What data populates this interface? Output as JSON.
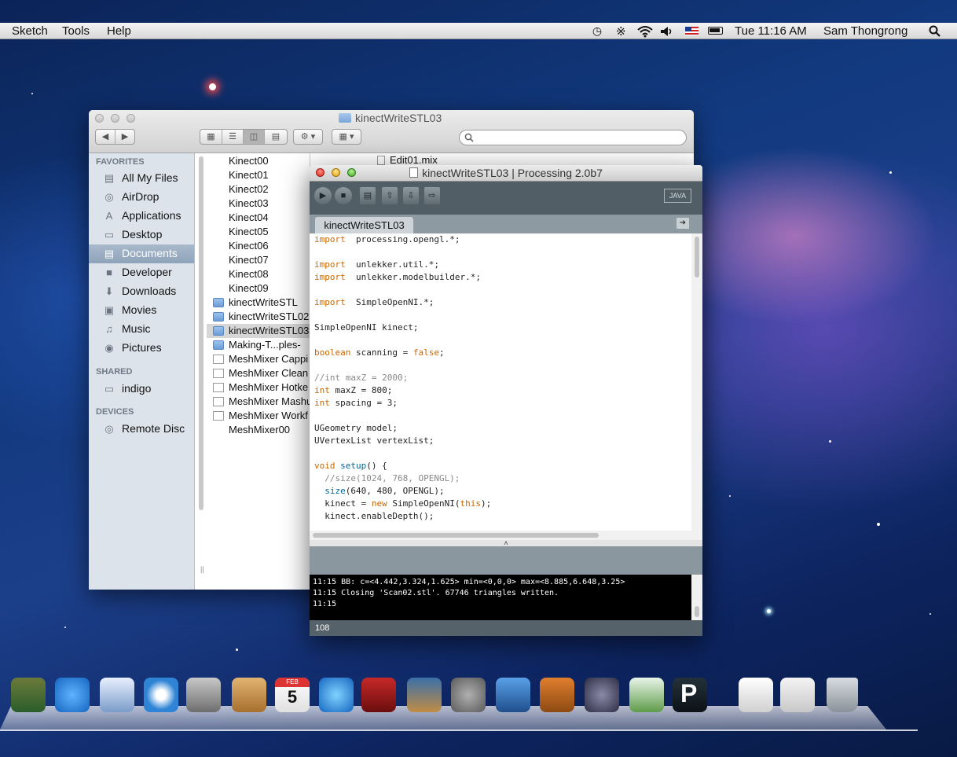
{
  "menubar": {
    "app_menus": [
      "Sketch",
      "Tools",
      "Help"
    ],
    "clock": "Tue 11:16 AM",
    "user": "Sam Thongrong",
    "icons": [
      "time-machine-icon",
      "bluetooth-icon",
      "wifi-icon",
      "volume-icon",
      "flag-icon",
      "battery-icon",
      "spotlight-icon"
    ]
  },
  "finder": {
    "title": "kinectWriteSTL03",
    "sidebar": {
      "favorites_heading": "FAVORITES",
      "favorites": [
        {
          "label": "All My Files",
          "icon": "all-files-icon"
        },
        {
          "label": "AirDrop",
          "icon": "airdrop-icon"
        },
        {
          "label": "Applications",
          "icon": "applications-icon"
        },
        {
          "label": "Desktop",
          "icon": "desktop-icon"
        },
        {
          "label": "Documents",
          "icon": "documents-icon",
          "selected": true
        },
        {
          "label": "Developer",
          "icon": "folder-icon"
        },
        {
          "label": "Downloads",
          "icon": "downloads-icon"
        },
        {
          "label": "Movies",
          "icon": "movies-icon"
        },
        {
          "label": "Music",
          "icon": "music-icon"
        },
        {
          "label": "Pictures",
          "icon": "pictures-icon"
        }
      ],
      "shared_heading": "SHARED",
      "shared": [
        {
          "label": "indigo",
          "icon": "computer-icon"
        }
      ],
      "devices_heading": "DEVICES",
      "devices": [
        {
          "label": "Remote Disc",
          "icon": "disc-icon"
        }
      ]
    },
    "files": [
      {
        "name": "Kinect00",
        "kind": "kinect"
      },
      {
        "name": "Kinect01",
        "kind": "kinect"
      },
      {
        "name": "Kinect02",
        "kind": "kinect"
      },
      {
        "name": "Kinect03",
        "kind": "kinect"
      },
      {
        "name": "Kinect04",
        "kind": "kinect"
      },
      {
        "name": "Kinect05",
        "kind": "kinect"
      },
      {
        "name": "Kinect06",
        "kind": "kinect"
      },
      {
        "name": "Kinect07",
        "kind": "kinect"
      },
      {
        "name": "Kinect08",
        "kind": "kinect"
      },
      {
        "name": "Kinect09",
        "kind": "kinect"
      },
      {
        "name": "kinectWriteSTL",
        "kind": "fold"
      },
      {
        "name": "kinectWriteSTL02",
        "kind": "fold"
      },
      {
        "name": "kinectWriteSTL03",
        "kind": "fold",
        "selected": true
      },
      {
        "name": "Making-T...ples-",
        "kind": "fold"
      },
      {
        "name": "MeshMixer Cappi",
        "kind": "doc"
      },
      {
        "name": "MeshMixer Clean",
        "kind": "doc"
      },
      {
        "name": "MeshMixer Hotke",
        "kind": "doc"
      },
      {
        "name": "MeshMixer Mashu",
        "kind": "doc"
      },
      {
        "name": "MeshMixer Workf",
        "kind": "doc"
      },
      {
        "name": "MeshMixer00",
        "kind": "kinect"
      }
    ],
    "second_column_file": "Edit01.mix"
  },
  "processing": {
    "title": "kinectWriteSTL03 | Processing 2.0b7",
    "mode": "JAVA",
    "tab": "kinectWriteSTL03",
    "code": [
      [
        [
          "kw",
          "import"
        ],
        [
          "",
          "  processing.opengl.*;"
        ]
      ],
      [],
      [
        [
          "kw",
          "import"
        ],
        [
          "",
          "  unlekker.util.*;"
        ]
      ],
      [
        [
          "kw",
          "import"
        ],
        [
          "",
          "  unlekker.modelbuilder.*;"
        ]
      ],
      [],
      [
        [
          "kw",
          "import"
        ],
        [
          "",
          "  SimpleOpenNI.*;"
        ]
      ],
      [],
      [
        [
          "",
          "SimpleOpenNI kinect;"
        ]
      ],
      [],
      [
        [
          "kw",
          "boolean"
        ],
        [
          "",
          " scanning = "
        ],
        [
          "kw",
          "false"
        ],
        [
          "",
          ";"
        ]
      ],
      [],
      [
        [
          "cm",
          "//int maxZ = 2000;"
        ]
      ],
      [
        [
          "kw",
          "int"
        ],
        [
          "",
          " maxZ = 800;"
        ]
      ],
      [
        [
          "kw",
          "int"
        ],
        [
          "",
          " spacing = 3;"
        ]
      ],
      [],
      [
        [
          "",
          "UGeometry model;"
        ]
      ],
      [
        [
          "",
          "UVertexList vertexList;"
        ]
      ],
      [],
      [
        [
          "kw",
          "void"
        ],
        [
          "",
          " "
        ],
        [
          "fn",
          "setup"
        ],
        [
          "",
          "() {"
        ]
      ],
      [
        [
          "cm",
          "  //size(1024, 768, OPENGL);"
        ]
      ],
      [
        [
          "",
          ""
        ],
        [
          "fn",
          "  size"
        ],
        [
          "",
          "(640, 480, OPENGL);"
        ]
      ],
      [
        [
          "",
          "  kinect = "
        ],
        [
          "kw",
          "new"
        ],
        [
          "",
          " SimpleOpenNI("
        ],
        [
          "kw",
          "this"
        ],
        [
          "",
          ");"
        ]
      ],
      [
        [
          "",
          "  kinect.enableDepth();"
        ]
      ]
    ],
    "console": [
      "11:15 BB: c=<4.442,3.324,1.625> min=<0,0,0> max=<8.885,6.648,3.25>",
      "11:15 Closing 'Scan02.stl'. 67746 triangles written.",
      "11:15"
    ],
    "line_number": "108"
  },
  "dock": {
    "icons": [
      "mission-control-icon",
      "app-store-icon",
      "mail-icon",
      "safari-icon",
      "facetime-icon",
      "address-book-icon",
      "calendar-icon",
      "itunes-icon",
      "photo-booth-icon",
      "iphoto-icon",
      "system-preferences-icon",
      "xcode-icon",
      "keynote-icon",
      "aperture-icon",
      "numbers-icon",
      "processing-icon",
      "documents-stack-icon",
      "screenshots-stack-icon",
      "trash-icon"
    ],
    "calendar_month": "FEB",
    "calendar_day": "5"
  }
}
